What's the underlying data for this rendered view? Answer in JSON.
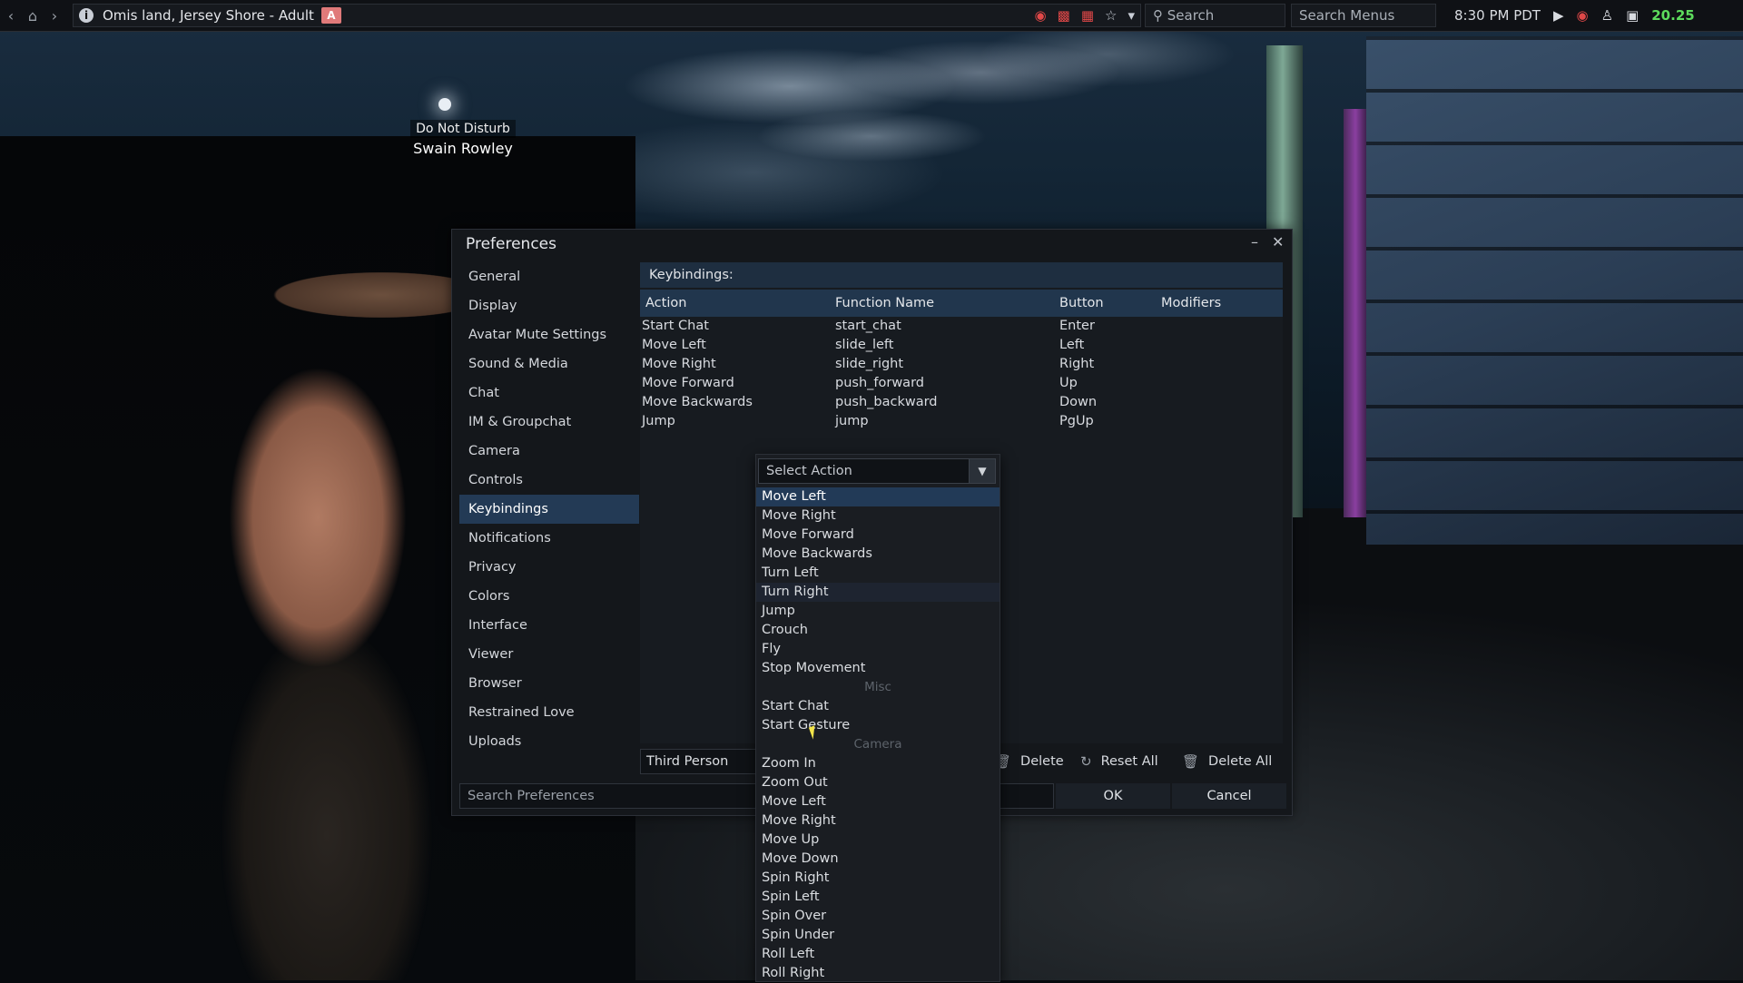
{
  "topbar": {
    "location": "Omis land, Jersey Shore - Adult",
    "maturity_badge": "A",
    "search_placeholder": "Search",
    "search_menus_placeholder": "Search Menus",
    "time": "8:30 PM PDT",
    "fps": "20.25"
  },
  "nametag": {
    "status": "Do Not Disturb",
    "name": "Swain Rowley"
  },
  "preferences": {
    "title": "Preferences",
    "sidebar": [
      {
        "label": "General"
      },
      {
        "label": "Display"
      },
      {
        "label": "Avatar Mute Settings"
      },
      {
        "label": "Sound & Media"
      },
      {
        "label": "Chat"
      },
      {
        "label": "IM & Groupchat"
      },
      {
        "label": "Camera"
      },
      {
        "label": "Controls"
      },
      {
        "label": "Keybindings"
      },
      {
        "label": "Notifications"
      },
      {
        "label": "Privacy"
      },
      {
        "label": "Colors"
      },
      {
        "label": "Interface"
      },
      {
        "label": "Viewer"
      },
      {
        "label": "Browser"
      },
      {
        "label": "Restrained Love"
      },
      {
        "label": "Uploads"
      }
    ],
    "active_section": "Keybindings",
    "keybindings_label": "Keybindings:",
    "columns": [
      "Action",
      "Function Name",
      "Button",
      "Modifiers"
    ],
    "rows": [
      {
        "action": "Start Chat",
        "function": "start_chat",
        "button": "Enter",
        "modifiers": ""
      },
      {
        "action": "Move Left",
        "function": "slide_left",
        "button": "Left",
        "modifiers": ""
      },
      {
        "action": "Move Right",
        "function": "slide_right",
        "button": "Right",
        "modifiers": ""
      },
      {
        "action": "Move Forward",
        "function": "push_forward",
        "button": "Up",
        "modifiers": ""
      },
      {
        "action": "Move Backwards",
        "function": "push_backward",
        "button": "Down",
        "modifiers": ""
      },
      {
        "action": "Jump",
        "function": "jump",
        "button": "PgUp",
        "modifiers": ""
      }
    ],
    "mode_value": "Third Person",
    "delete_label": "Delete",
    "reset_all_label": "Reset All",
    "delete_all_label": "Delete All",
    "search_placeholder": "Search Preferences",
    "ok_label": "OK",
    "cancel_label": "Cancel"
  },
  "dropdown": {
    "placeholder": "Select Action",
    "items": [
      {
        "label": "Move Left",
        "state": "selected"
      },
      {
        "label": "Move Right",
        "state": ""
      },
      {
        "label": "Move Forward",
        "state": ""
      },
      {
        "label": "Move Backwards",
        "state": ""
      },
      {
        "label": "Turn Left",
        "state": ""
      },
      {
        "label": "Turn Right",
        "state": "hover"
      },
      {
        "label": "Jump",
        "state": ""
      },
      {
        "label": "Crouch",
        "state": ""
      },
      {
        "label": "Fly",
        "state": ""
      },
      {
        "label": "Stop Movement",
        "state": ""
      },
      {
        "label": "Misc",
        "state": "group"
      },
      {
        "label": "Start Chat",
        "state": ""
      },
      {
        "label": "Start Gesture",
        "state": ""
      },
      {
        "label": "Camera",
        "state": "group"
      },
      {
        "label": "Zoom In",
        "state": ""
      },
      {
        "label": "Zoom Out",
        "state": ""
      },
      {
        "label": "Move Left",
        "state": ""
      },
      {
        "label": "Move Right",
        "state": ""
      },
      {
        "label": "Move Up",
        "state": ""
      },
      {
        "label": "Move Down",
        "state": ""
      },
      {
        "label": "Spin Right",
        "state": ""
      },
      {
        "label": "Spin Left",
        "state": ""
      },
      {
        "label": "Spin Over",
        "state": ""
      },
      {
        "label": "Spin Under",
        "state": ""
      },
      {
        "label": "Roll Left",
        "state": ""
      },
      {
        "label": "Roll Right",
        "state": ""
      }
    ]
  },
  "colors": {
    "accent": "#223a57",
    "fps_green": "#5ddb5d",
    "maturity_red": "#e07a7a"
  }
}
